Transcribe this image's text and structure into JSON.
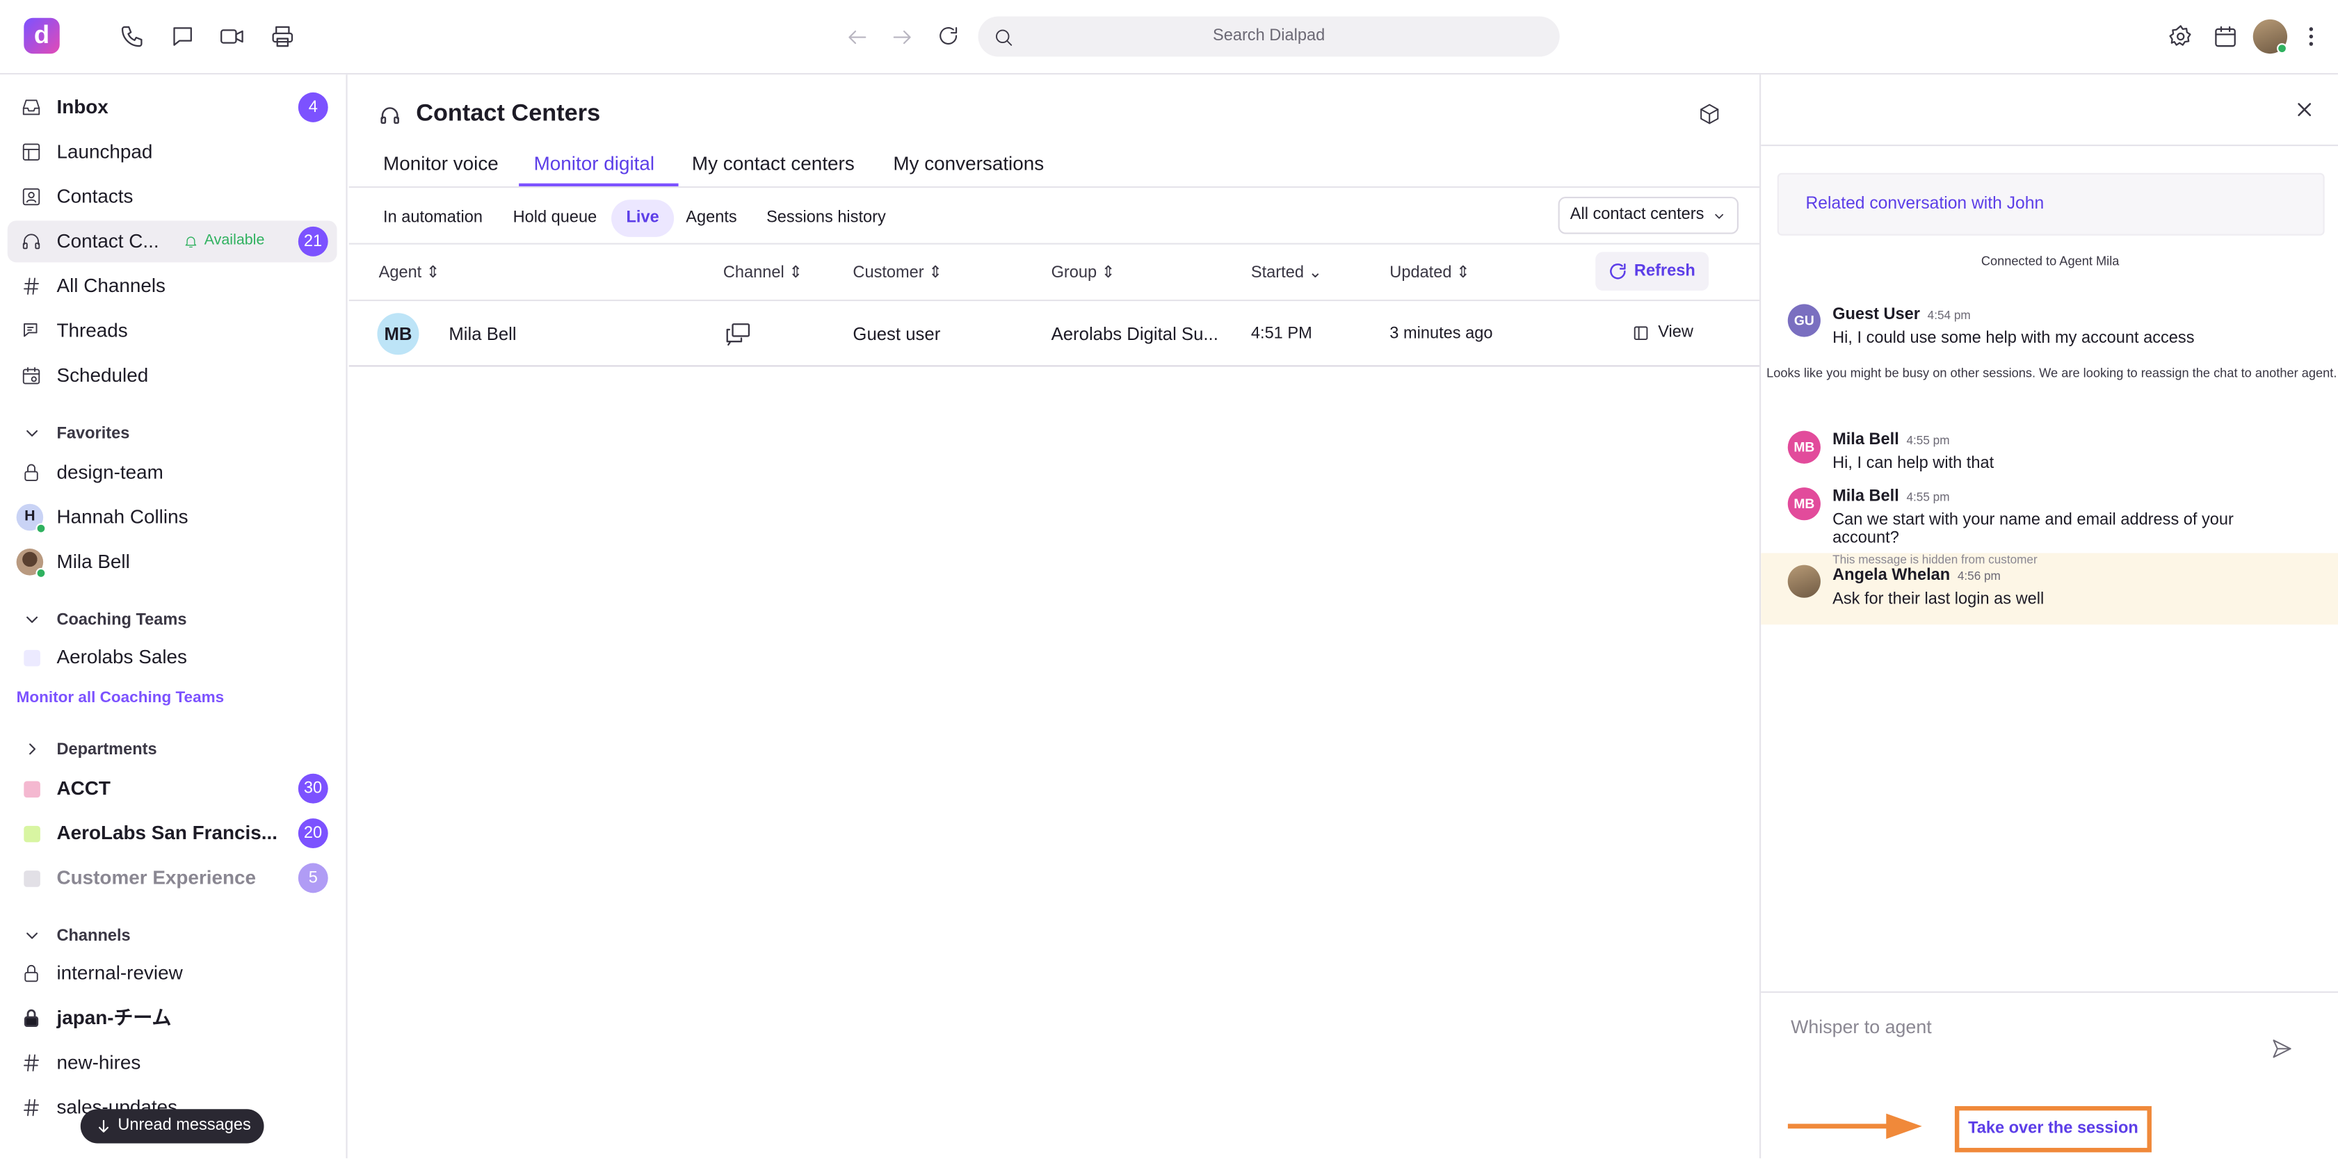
{
  "topbar": {
    "logo_letter": "d",
    "search_placeholder": "Search Dialpad"
  },
  "sidebar": {
    "items": [
      {
        "label": "Inbox",
        "badge": "4"
      },
      {
        "label": "Launchpad"
      },
      {
        "label": "Contacts"
      },
      {
        "label": "Contact C...",
        "status": "Available",
        "badge": "21"
      },
      {
        "label": "All Channels"
      },
      {
        "label": "Threads"
      },
      {
        "label": "Scheduled"
      }
    ],
    "favorites": {
      "title": "Favorites",
      "items": [
        {
          "label": "design-team"
        },
        {
          "label": "Hannah Collins",
          "initial": "H"
        },
        {
          "label": "Mila Bell"
        }
      ]
    },
    "coaching": {
      "title": "Coaching Teams",
      "items": [
        {
          "label": "Aerolabs Sales"
        }
      ],
      "link": "Monitor all Coaching Teams"
    },
    "departments": {
      "title": "Departments",
      "items": [
        {
          "label": "ACCT",
          "badge": "30",
          "color": "#f4b8d0"
        },
        {
          "label": "AeroLabs San Francis...",
          "badge": "20",
          "color": "#d8f5a2"
        },
        {
          "label": "Customer Experience",
          "badge": "5",
          "color": "#e2e0e6"
        }
      ]
    },
    "channels": {
      "title": "Channels",
      "items": [
        {
          "label": "internal-review"
        },
        {
          "label": "japan-チーム"
        },
        {
          "label": "new-hires"
        },
        {
          "label": "sales-updates"
        }
      ]
    },
    "unread_toast": "Unread messages"
  },
  "main": {
    "title": "Contact Centers",
    "tabs": [
      "Monitor voice",
      "Monitor digital",
      "My contact centers",
      "My conversations"
    ],
    "subtabs": [
      "In automation",
      "Hold queue",
      "Live",
      "Agents",
      "Sessions history"
    ],
    "filter": "All contact centers",
    "columns": [
      "Agent",
      "Channel",
      "Customer",
      "Group",
      "Started",
      "Updated"
    ],
    "refresh_label": "Refresh",
    "rows": [
      {
        "agent_initials": "MB",
        "agent": "Mila Bell",
        "customer": "Guest user",
        "group": "Aerolabs Digital Su...",
        "started": "4:51 PM",
        "updated": "3 minutes ago",
        "action": "View"
      }
    ]
  },
  "panel": {
    "related": "Related conversation with John",
    "connected": "Connected to Agent Mila",
    "messages": [
      {
        "initials": "GU",
        "name": "Guest User",
        "time": "4:54 pm",
        "text": "Hi, I could use some help with my account access"
      },
      {
        "initials": "MB",
        "name": "Mila Bell",
        "time": "4:55 pm",
        "text": "Hi, I can help with that"
      },
      {
        "initials": "MB",
        "name": "Mila Bell",
        "time": "4:55 pm",
        "text": "Can we start with your name and email address of your account?"
      },
      {
        "name": "Angela Whelan",
        "time": "4:56 pm",
        "text": "Ask for their last login as well",
        "note": "This message is hidden from customer"
      }
    ],
    "system_message": "Looks like you might be busy on other sessions. We are looking to reassign the chat to another agent.",
    "whisper_placeholder": "Whisper to agent",
    "take_over": "Take over the session"
  },
  "colors": {
    "accent": "#7c52ff",
    "highlight": "#f0893a",
    "available": "#2fb15f"
  }
}
